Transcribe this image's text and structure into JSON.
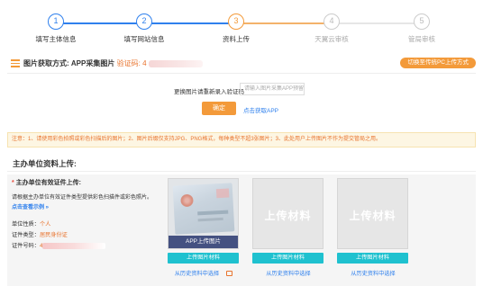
{
  "steps": [
    {
      "num": "1",
      "label": "填写主体信息",
      "state": "done"
    },
    {
      "num": "2",
      "label": "填写网站信息",
      "state": "done"
    },
    {
      "num": "3",
      "label": "资料上传",
      "state": "current"
    },
    {
      "num": "4",
      "label": "天翼云审核",
      "state": "pending"
    },
    {
      "num": "5",
      "label": "管局审核",
      "state": "pending"
    }
  ],
  "method_bar": {
    "title": "图片获取方式:",
    "method": "APP采集图片",
    "code_label": "验证码:",
    "code_value": "4",
    "switch_label": "切换至传统PC上传方式"
  },
  "code_area": {
    "label": "更换图片请重新录入验证码",
    "placeholder": "请输入图片采集APP预留",
    "confirm_label": "确定",
    "get_app_label": "点击获取APP"
  },
  "notice": "注意：1、请使用彩色拍照或彩色扫描后的图片；2、图片后缀仅支持JPG、PNG格式，每种类型不超3张图片；3、此处用户上传图片不作为提交管局之用。",
  "section": {
    "title": "主办单位资料上传:",
    "req_title": "主办单位有效证件上传:",
    "req_desc": "请根据主办单位有效证件类型提供彩色扫描件或彩色照片。",
    "example_link": "点击查看示例 »",
    "info": {
      "unit_nature_label": "单位性质：",
      "unit_nature_value": "个人",
      "cert_type_label": "证件类型：",
      "cert_type_value": "居民身份证",
      "cert_no_label": "证件号码：",
      "cert_no_value": "4"
    }
  },
  "cards": [
    {
      "caption": "APP上传图片",
      "placeholder": "",
      "upload_label": "上传图片材料",
      "history_label": "从历史资料中选择"
    },
    {
      "caption": "",
      "placeholder": "上传材料",
      "upload_label": "上传图片材料",
      "history_label": "从历史资料中选择"
    },
    {
      "caption": "",
      "placeholder": "上传材料",
      "upload_label": "上传图片材料",
      "history_label": "从历史资料中选择"
    }
  ],
  "colors": {
    "accent": "#f39a3a",
    "blue": "#2f80ed",
    "teal": "#1fc1cf"
  }
}
